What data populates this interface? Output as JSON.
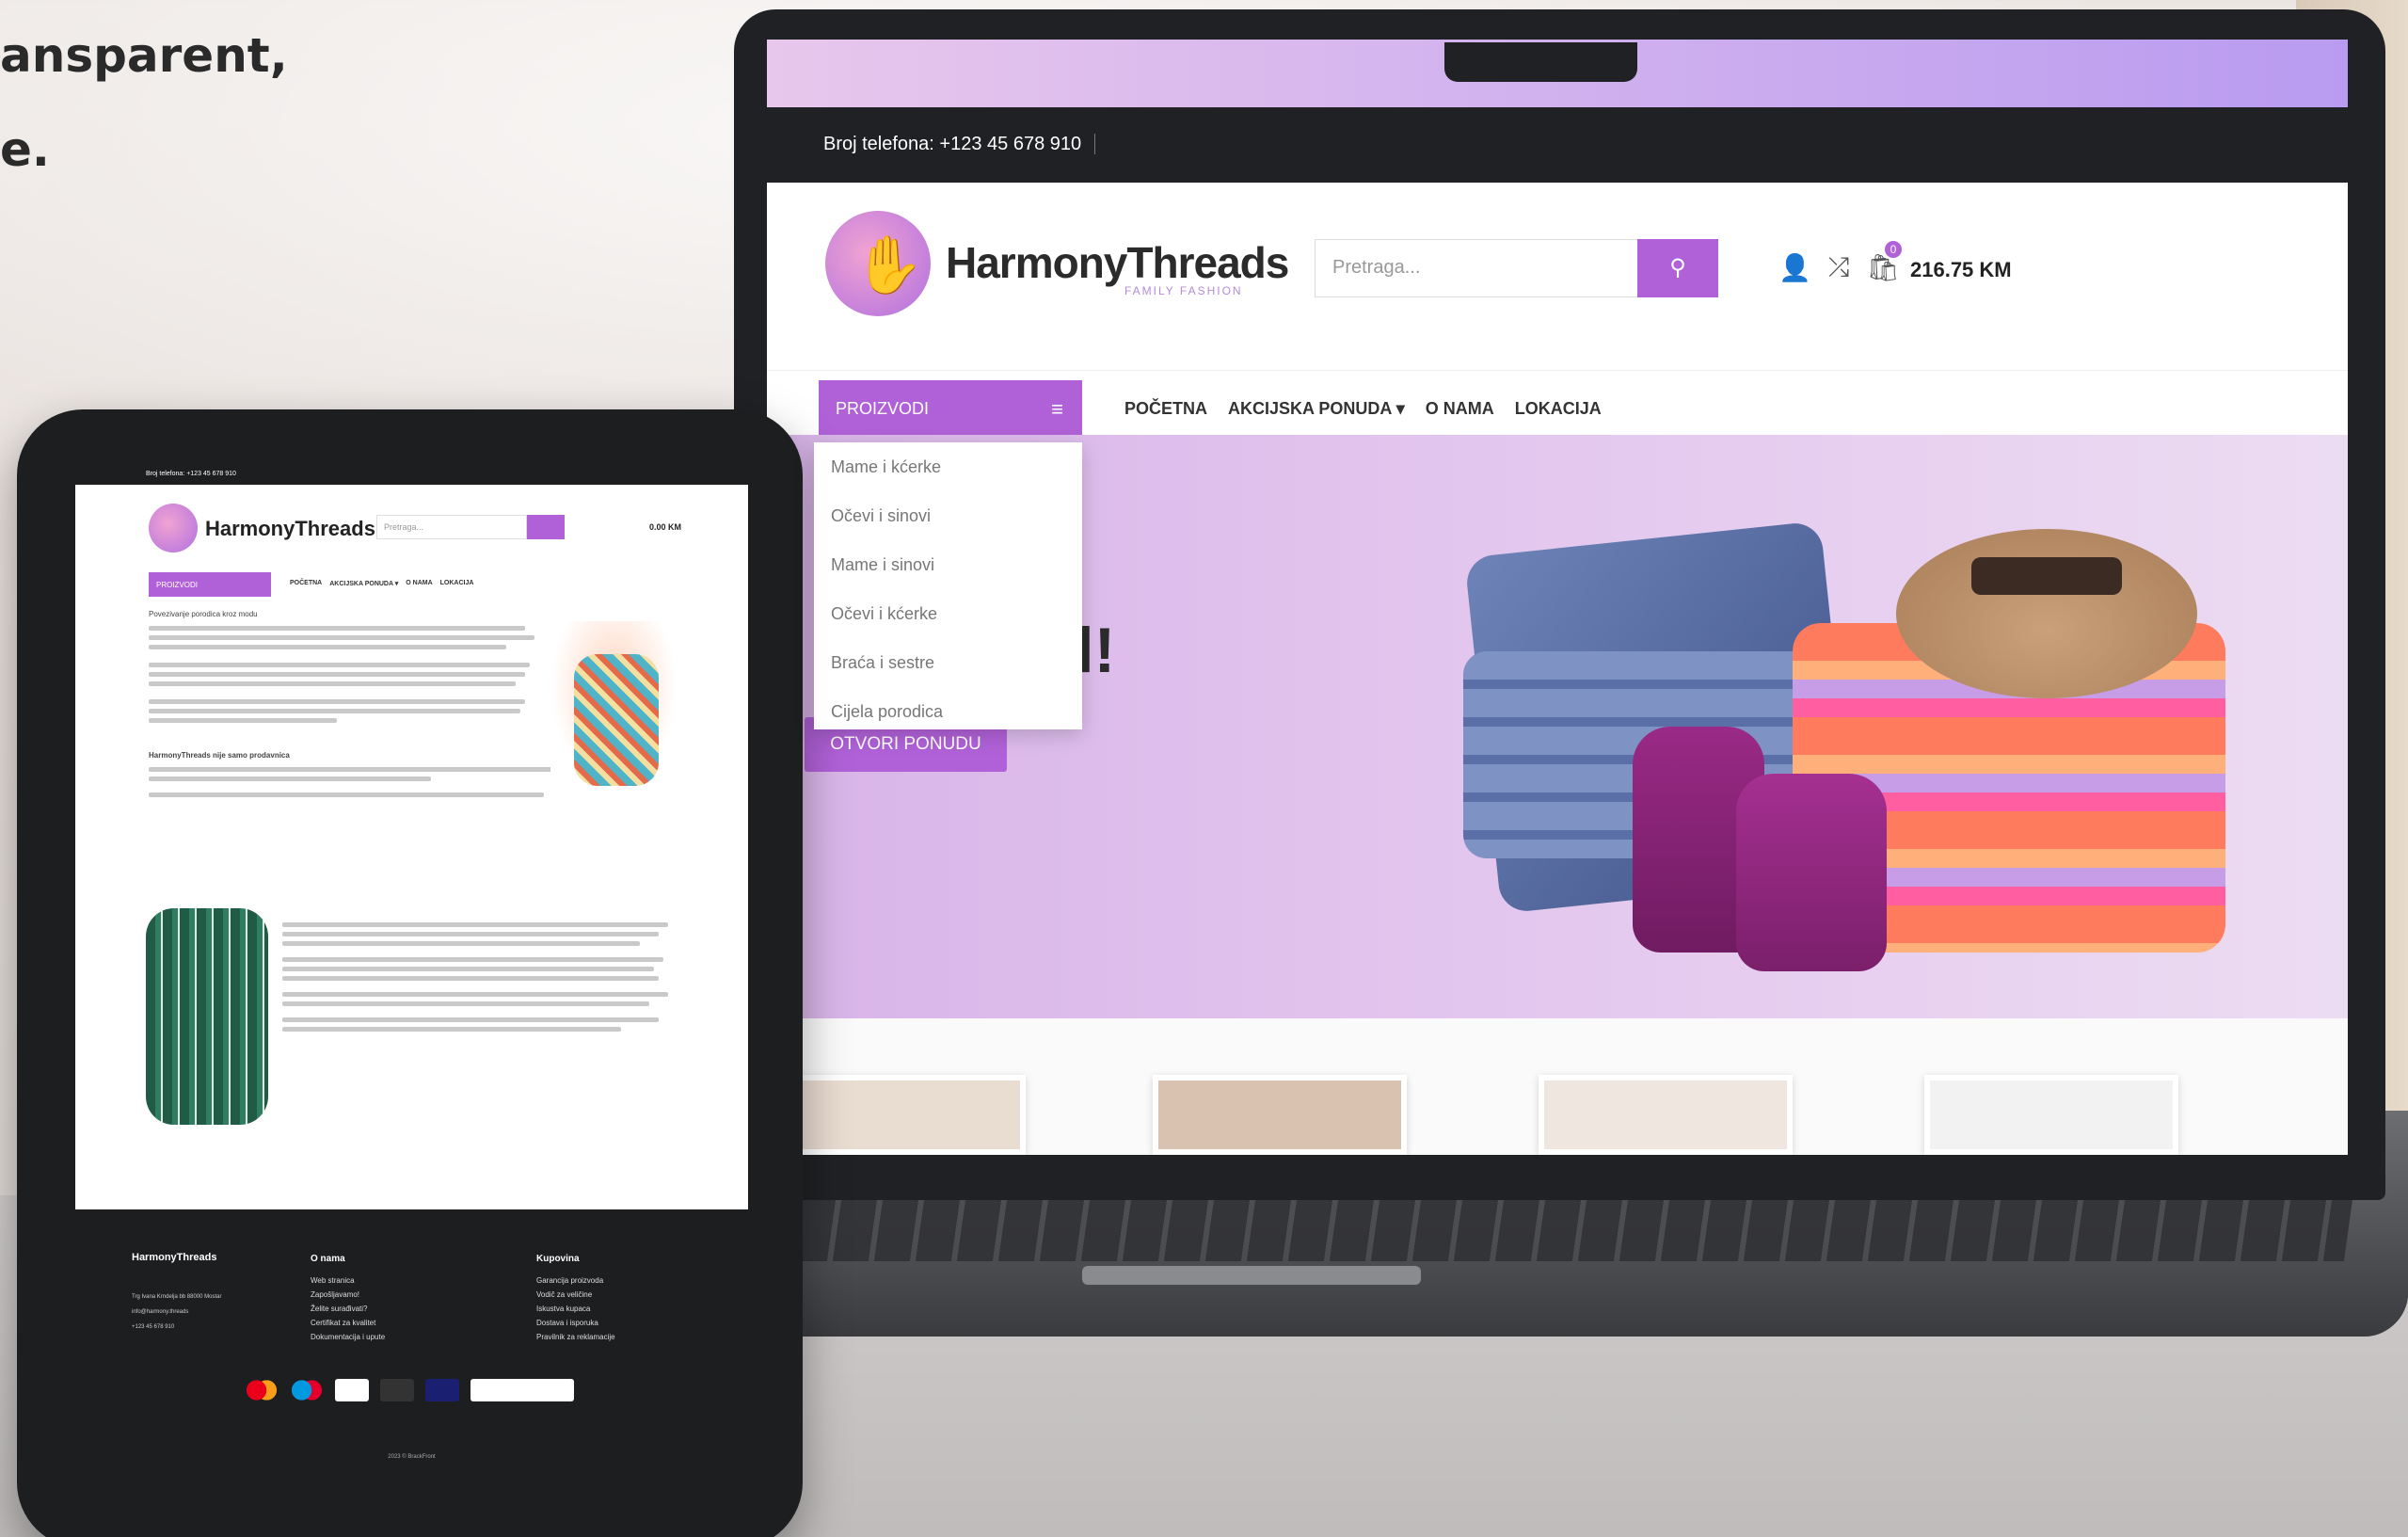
{
  "tagline": {
    "line1": "ansparent,",
    "line2": "e."
  },
  "desktop": {
    "phone": "Broj telefona: +123 45 678 910",
    "brand": "HarmonyThreads",
    "brand_sub": "FAMILY FASHION",
    "search_placeholder": "Pretraga...",
    "cart_count": "0",
    "cart_total": "216.75 KM",
    "products_label": "PROIZVODI",
    "nav": [
      "POČETNA",
      "AKCIJSKA PONUDA ▾",
      "O NAMA",
      "LOKACIJA"
    ],
    "dropdown": [
      "Mame i kćerke",
      "Očevi i sinovi",
      "Mame i sinovi",
      "Očevi i kćerke",
      "Braća i sestre",
      "Cijela porodica"
    ],
    "hero_text": "oj stil!",
    "hero_button": "OTVORI PONUDU"
  },
  "tablet": {
    "phone": "Broj telefona: +123 45 678 910",
    "brand": "HarmonyThreads",
    "search_placeholder": "Pretraga...",
    "cart_total": "0.00 KM",
    "products_label": "PROIZVODI",
    "nav": [
      "POČETNA",
      "AKCIJSKA PONUDA ▾",
      "O NAMA",
      "LOKACIJA"
    ],
    "intro": "Povezivanje porodica kroz modu",
    "heading2": "HarmonyThreads nije samo prodavnica",
    "footer": {
      "brand": "HarmonyThreads",
      "address": "Trg Ivana Krndelja bb 88000 Mostar",
      "email": "info@harmony.threads",
      "phone": "+123 45 678 910",
      "col1_title": "O nama",
      "col1": [
        "Web stranica",
        "Zapošljavamo!",
        "Želite surađivati?",
        "Certifikat za kvalitet",
        "Dokumentacija i upute"
      ],
      "col2_title": "Kupovina",
      "col2": [
        "Garancija proizvoda",
        "Vodič za veličine",
        "Iskustva kupaca",
        "Dostava i isporuka",
        "Pravilnik za reklamacije"
      ],
      "copyright": "2023 © BrackFront"
    }
  },
  "colors": {
    "accent": "#b061d7",
    "dark": "#1d1e20"
  }
}
